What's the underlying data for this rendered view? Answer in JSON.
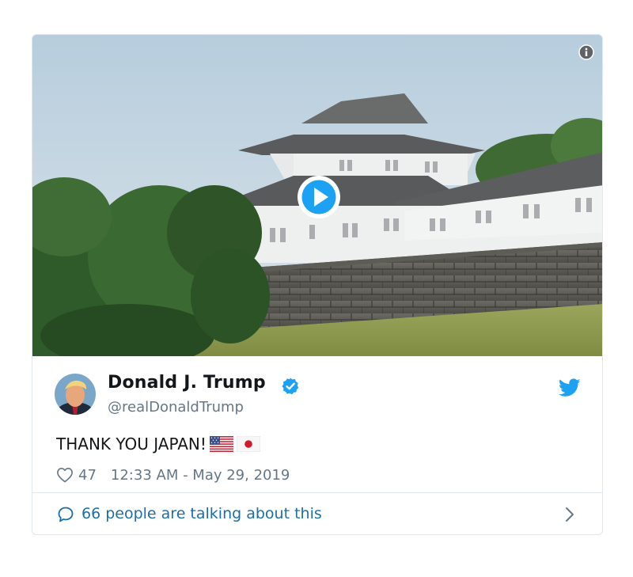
{
  "author": {
    "name": "Donald J. Trump",
    "handle": "@realDonaldTrump",
    "verified": true
  },
  "tweet": {
    "text": "THANK YOU JAPAN!",
    "emoji": [
      "us-flag",
      "japan-flag"
    ],
    "likes": "47",
    "timestamp": "12:33 AM - May 29, 2019"
  },
  "conversation": {
    "label": "66 people are talking about this"
  },
  "icons": {
    "info": "info-icon",
    "play": "play-icon",
    "verified": "verified-badge-icon",
    "brand": "twitter-bird-icon",
    "like": "heart-icon",
    "reply": "speech-bubble-icon",
    "more": "chevron-right-icon"
  },
  "colors": {
    "brand_blue": "#1da1f2",
    "link_blue": "#1b6fa8",
    "text_primary": "#14171a",
    "text_secondary": "#657786",
    "border": "#e1e8ed"
  }
}
